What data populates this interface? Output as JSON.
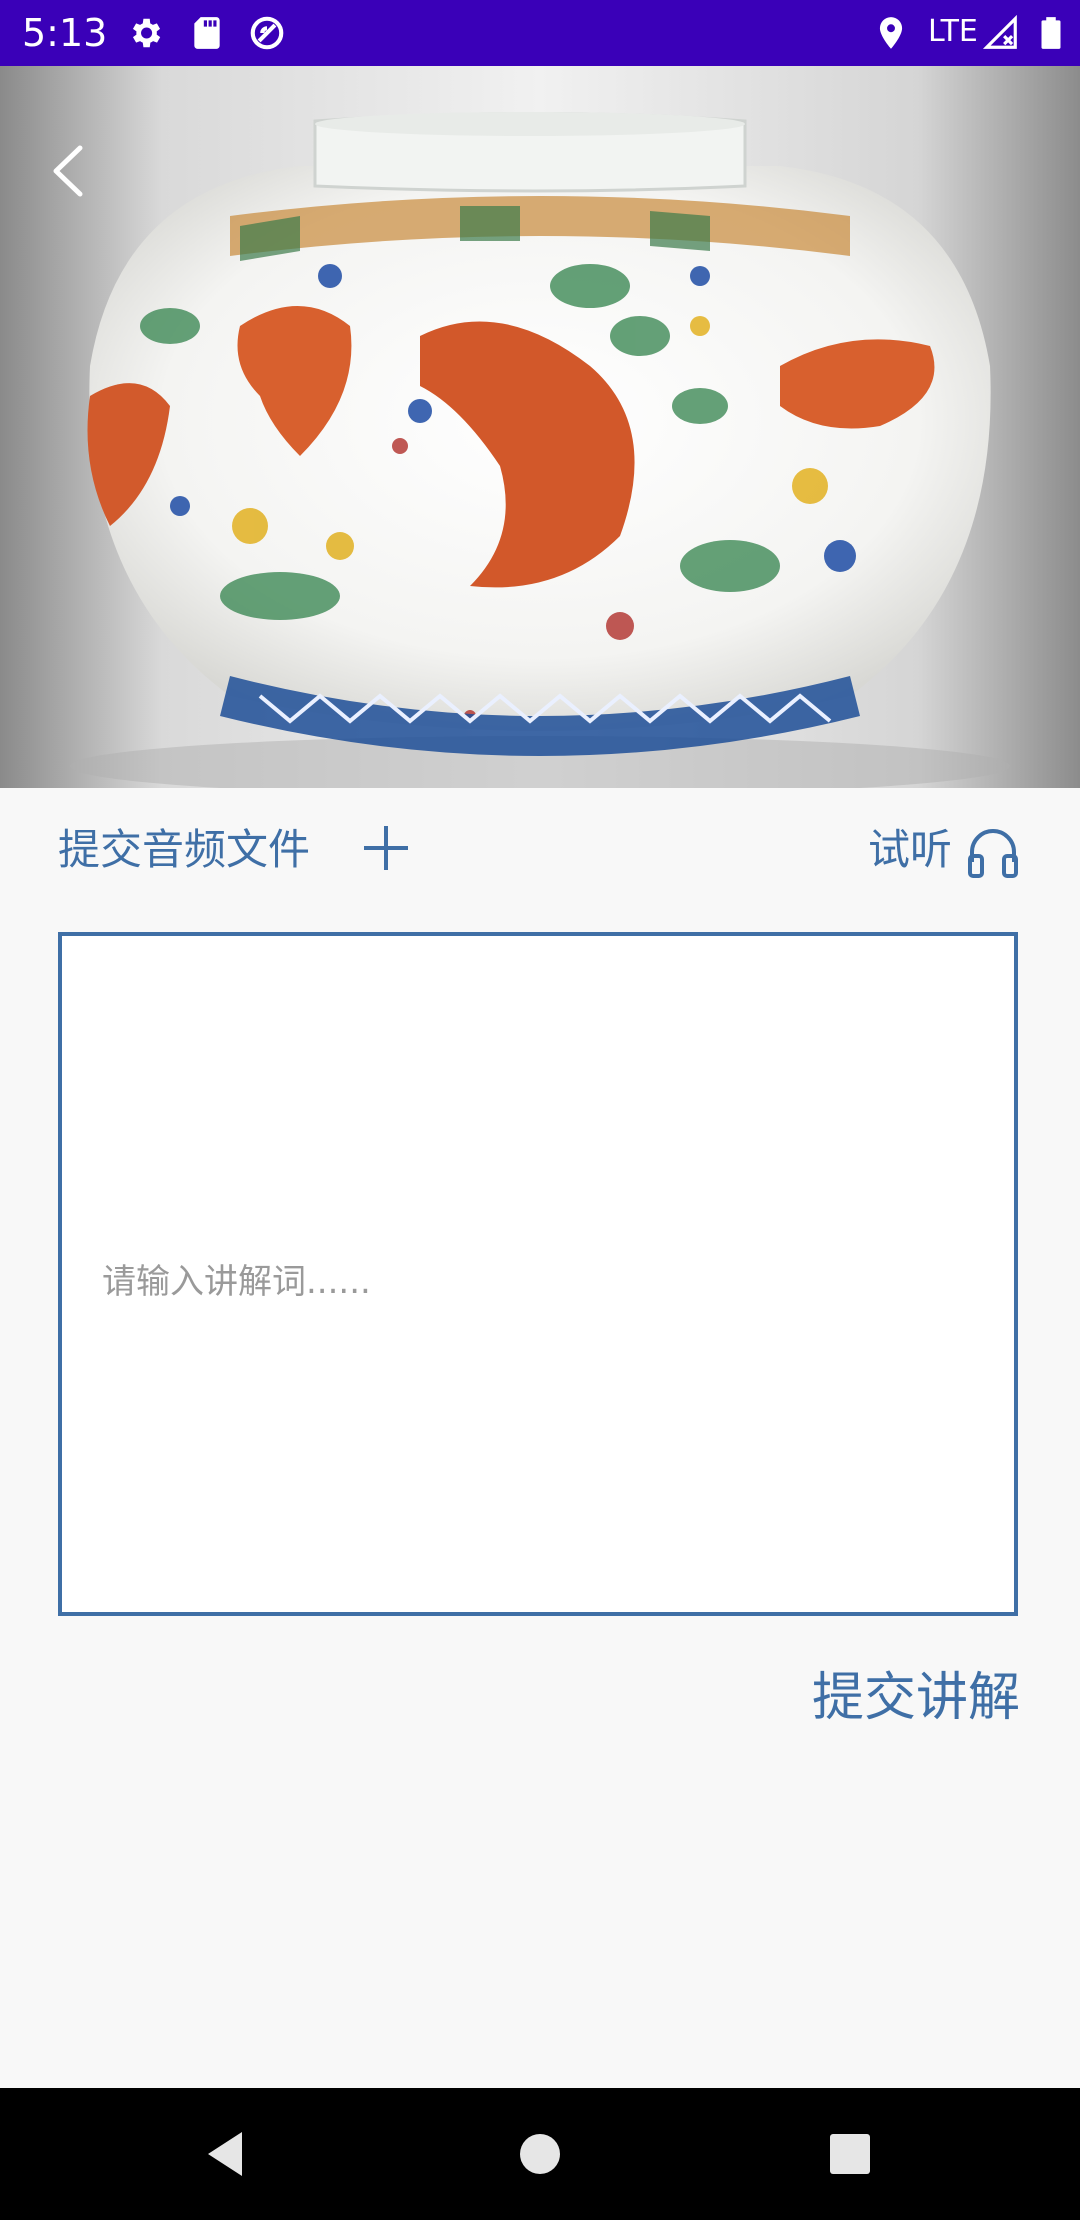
{
  "status_bar": {
    "time": "5:13",
    "network": "LTE",
    "icons": [
      "gear-icon",
      "sd-card-icon",
      "vpn-icon",
      "location-icon",
      "signal-icon",
      "battery-icon"
    ]
  },
  "hero": {
    "image_alt": "porcelain-jar-with-fish-image"
  },
  "actions": {
    "upload_audio_label": "提交音频文件",
    "preview_label": "试听"
  },
  "narration": {
    "placeholder": "请输入讲解词......",
    "value": ""
  },
  "submit_label": "提交讲解",
  "colors": {
    "status_bar": "#3a00b8",
    "accent": "#3f6fa6",
    "background": "#f8f8f8",
    "nav_bar": "#000000"
  }
}
